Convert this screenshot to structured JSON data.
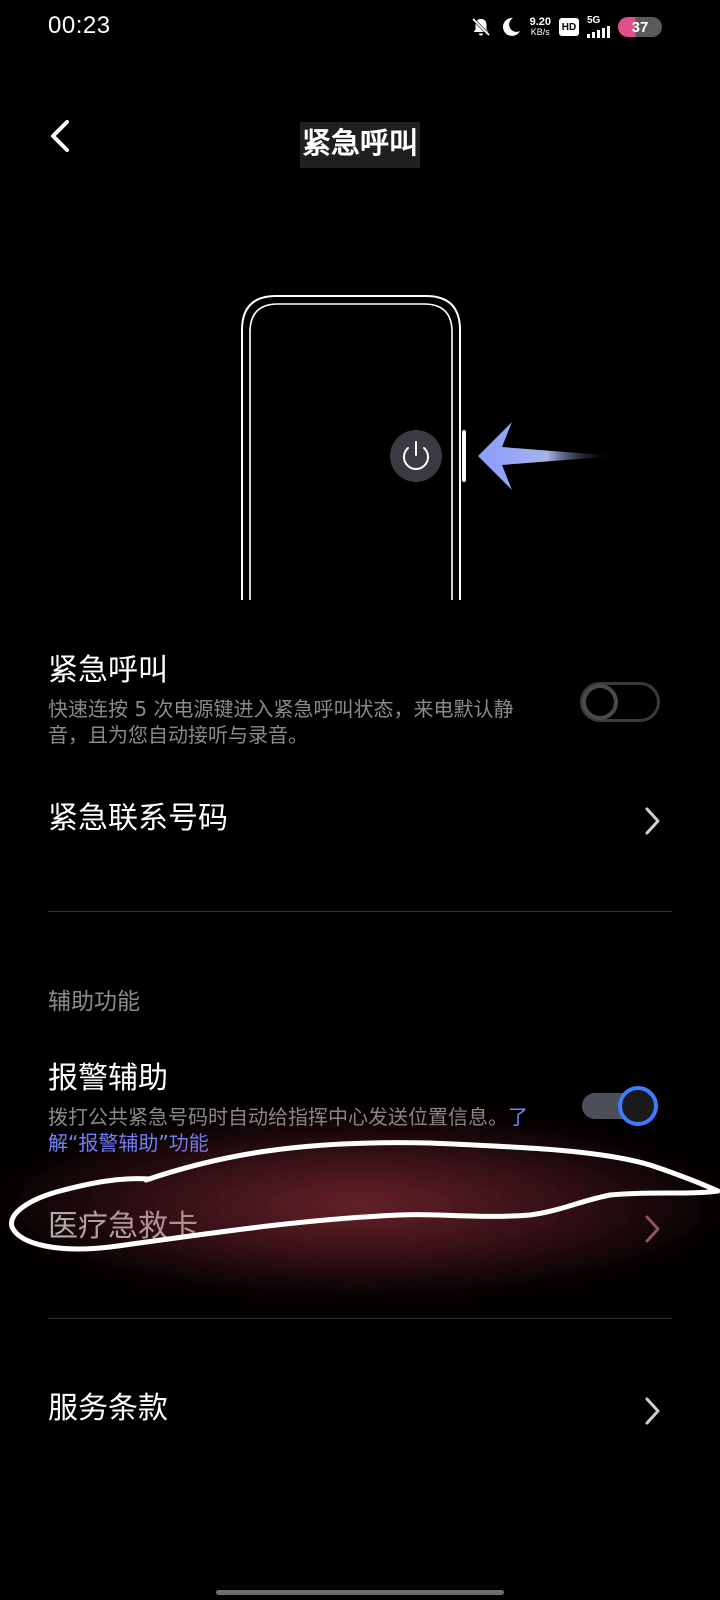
{
  "status_bar": {
    "time": "00:23",
    "net_speed_value": "9.20",
    "net_speed_unit": "KB/s",
    "hd_label": "HD",
    "network_type": "5G",
    "battery_level": "37",
    "icons": [
      "mute-bell-icon",
      "do-not-disturb-moon-icon",
      "hd-icon",
      "signal-icon",
      "battery-icon"
    ]
  },
  "header": {
    "title": "紧急呼叫",
    "back_icon": "chevron-left-icon"
  },
  "illustration": {
    "icons": [
      "phone-outline",
      "power-icon",
      "arrow-left-icon"
    ]
  },
  "settings": {
    "emergency_call": {
      "title": "紧急呼叫",
      "description": "快速连按 5 次电源键进入紧急呼叫状态，来电默认静音，且为您自动接听与录音。",
      "enabled": false
    },
    "emergency_contacts": {
      "title": "紧急联系号码"
    },
    "section_header": "辅助功能",
    "alarm_assist": {
      "title": "报警辅助",
      "description_prefix": "拨打公共紧急号码时自动给指挥中心发送位置信息。",
      "description_link": "了解“报警辅助”功能",
      "enabled": true
    },
    "medical_card": {
      "title": "医疗急救卡"
    },
    "terms": {
      "title": "服务条款"
    }
  },
  "colors": {
    "background": "#000000",
    "text_primary": "#ffffff",
    "text_secondary": "#8a8a8a",
    "link": "#6f86ff",
    "toggle_on": "#3d7bff",
    "battery_accent": "#e0508a",
    "annotation_glow": "#c84050"
  }
}
